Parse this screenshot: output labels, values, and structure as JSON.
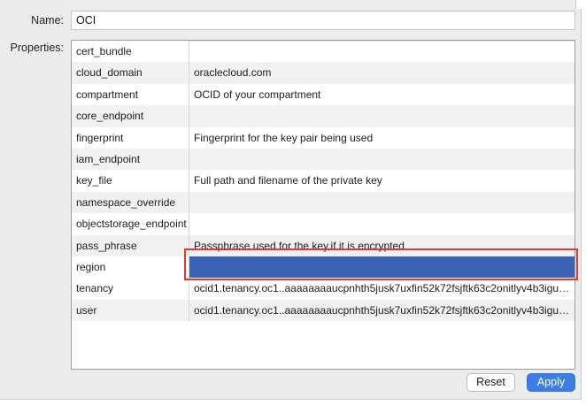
{
  "form": {
    "name_label": "Name:",
    "name_value": "OCI",
    "properties_label": "Properties:"
  },
  "properties": [
    {
      "key": "cert_bundle",
      "value": ""
    },
    {
      "key": "cloud_domain",
      "value": "oraclecloud.com"
    },
    {
      "key": "compartment",
      "value": "OCID of your compartment"
    },
    {
      "key": "core_endpoint",
      "value": ""
    },
    {
      "key": "fingerprint",
      "value": "Fingerprint for the key pair being used"
    },
    {
      "key": "iam_endpoint",
      "value": ""
    },
    {
      "key": "key_file",
      "value": "Full path and filename of the private key"
    },
    {
      "key": "namespace_override",
      "value": ""
    },
    {
      "key": "objectstorage_endpoint",
      "value": ""
    },
    {
      "key": "pass_phrase",
      "value": "Passphrase used for the key,if it is encrypted"
    },
    {
      "key": "region",
      "value": "",
      "selected": true
    },
    {
      "key": "tenancy",
      "value": "ocid1.tenancy.oc1..aaaaaaaaucpnhth5jusk7uxfin52k72fsjftk63c2onitlyv4b3igudv..."
    },
    {
      "key": "user",
      "value": "ocid1.tenancy.oc1..aaaaaaaaucpnhth5jusk7uxfin52k72fsjftk63c2onitlyv4b3igudv..."
    }
  ],
  "buttons": {
    "reset_label": "Reset",
    "apply_label": "Apply"
  },
  "colors": {
    "selection": "#3a62b5",
    "highlight_border": "#e23b2e",
    "apply_button": "#3d7ee6"
  }
}
